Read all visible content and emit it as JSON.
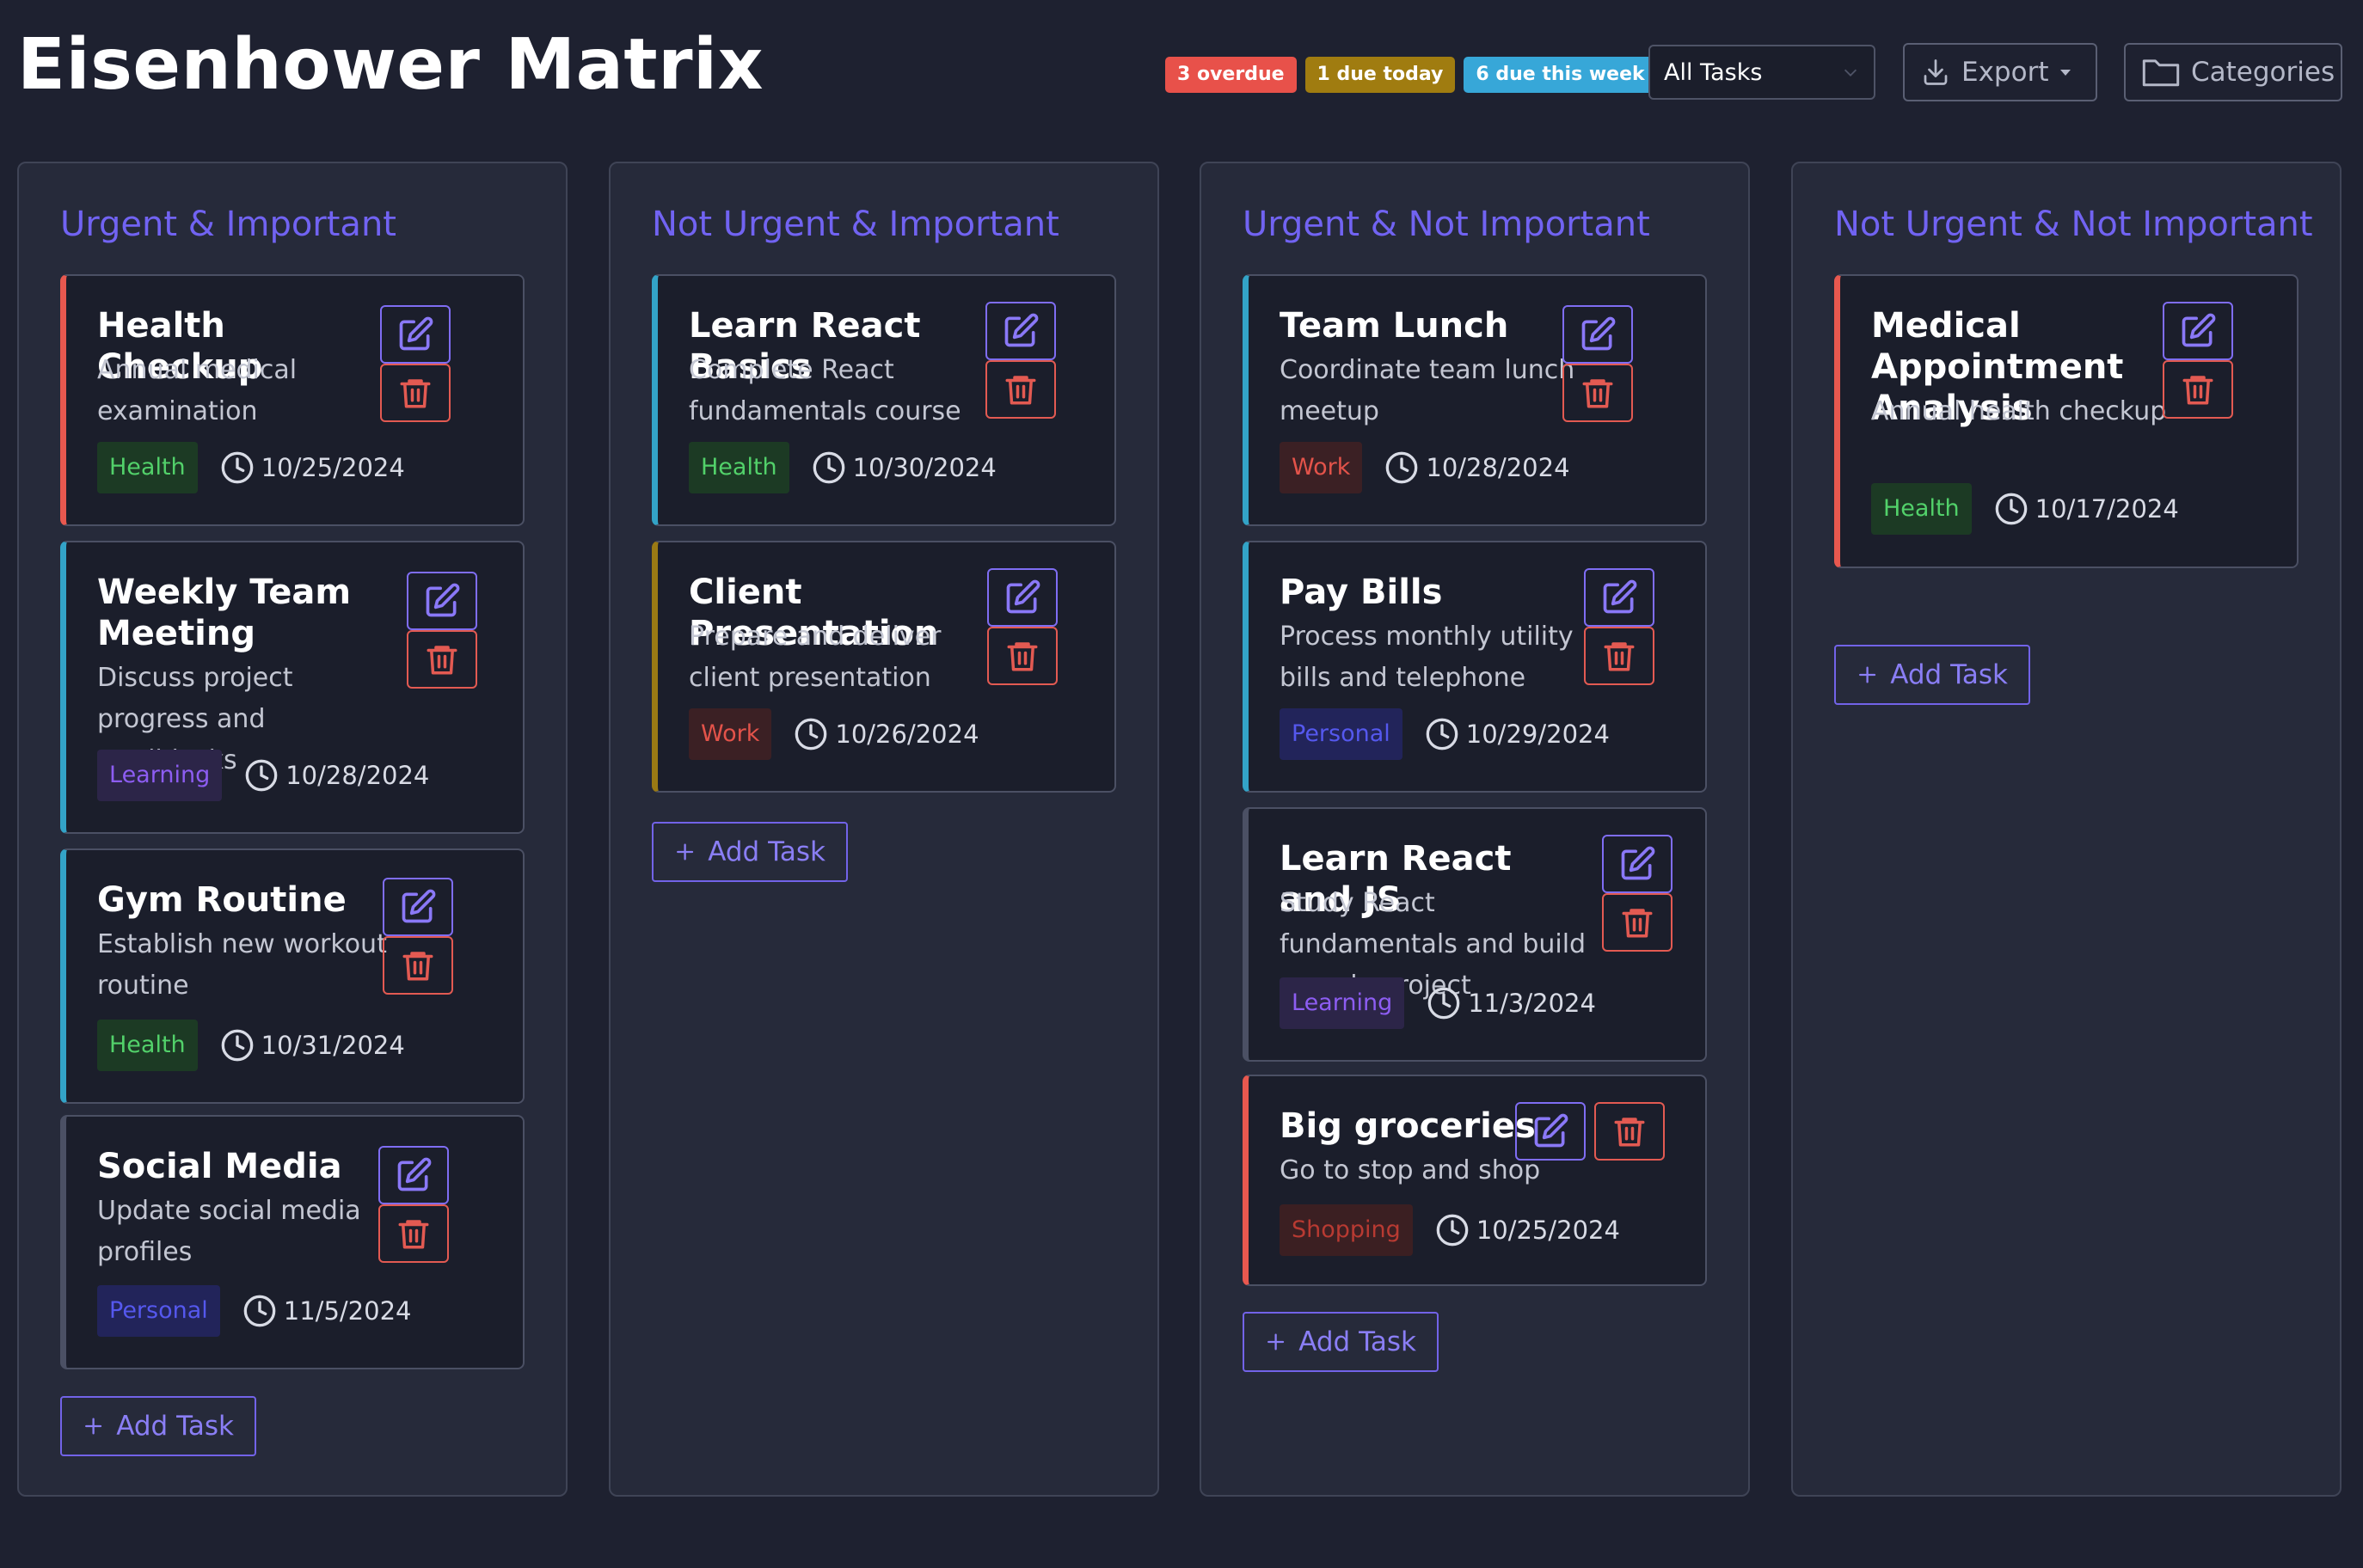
{
  "header": {
    "title": "Eisenhower Matrix",
    "badges": {
      "overdue": "3 overdue",
      "today": "1 due today",
      "week": "6 due this week"
    },
    "filter_value": "All Tasks",
    "export_label": "Export",
    "categories_label": "Categories"
  },
  "colors": {
    "accent": "#7163f2",
    "overdue": "#e8514a",
    "due_today": "#a07c10",
    "due_week": "#37a7d8",
    "delete": "#e35a52"
  },
  "add_task_label": "Add Task",
  "icons": [
    "chevron-down-icon",
    "download-icon",
    "caret-down-icon",
    "folder-icon",
    "edit-icon",
    "trash-icon",
    "clock-icon",
    "plus-icon"
  ],
  "columns": [
    {
      "title": "Urgent & Important",
      "tasks": [
        {
          "title": "Health Checkup",
          "description": "Annual medical examination",
          "tag": "Health",
          "due": "10/25/2024",
          "accent": "red"
        },
        {
          "title": "Weekly Team Meeting",
          "description": "Discuss project progress and roadblocks",
          "tag": "Learning",
          "due": "10/28/2024",
          "accent": "blue"
        },
        {
          "title": "Gym Routine",
          "description": "Establish new workout routine",
          "tag": "Health",
          "due": "10/31/2024",
          "accent": "blue"
        },
        {
          "title": "Social Media",
          "description": "Update social media profiles",
          "tag": "Personal",
          "due": "11/5/2024",
          "accent": "none"
        }
      ]
    },
    {
      "title": "Not Urgent & Important",
      "tasks": [
        {
          "title": "Learn React Basics",
          "description": "Complete React fundamentals course",
          "tag": "Health",
          "due": "10/30/2024",
          "accent": "blue"
        },
        {
          "title": "Client Presentation",
          "description": "Prepare and deliver client presentation",
          "tag": "Work",
          "due": "10/26/2024",
          "accent": "olive"
        }
      ]
    },
    {
      "title": "Urgent & Not Important",
      "tasks": [
        {
          "title": "Team Lunch",
          "description": "Coordinate team lunch meetup",
          "tag": "Work",
          "due": "10/28/2024",
          "accent": "blue"
        },
        {
          "title": "Pay Bills",
          "description": "Process monthly utility bills and telephone",
          "tag": "Personal",
          "due": "10/29/2024",
          "accent": "blue"
        },
        {
          "title": "Learn React and JS",
          "description": "Study React fundamentals and build sample project",
          "tag": "Learning",
          "due": "11/3/2024",
          "accent": "none"
        },
        {
          "title": "Big groceries",
          "description": "Go to stop and shop",
          "tag": "Shopping",
          "due": "10/25/2024",
          "accent": "red"
        }
      ]
    },
    {
      "title": "Not Urgent & Not Important",
      "tasks": [
        {
          "title": "Medical Appointment Analysis",
          "description": "Annual health checkup",
          "tag": "Health",
          "due": "10/17/2024",
          "accent": "red"
        }
      ]
    }
  ]
}
